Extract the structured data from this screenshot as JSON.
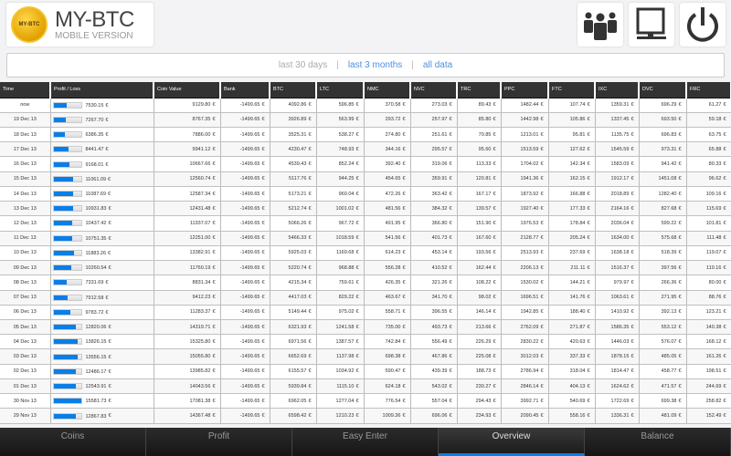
{
  "app": {
    "logo_coin_text": "MY-BTC",
    "title": "MY-BTC",
    "subtitle": "MOBILE VERSION"
  },
  "toolbar": {
    "icons": [
      "users-icon",
      "monitor-icon",
      "power-icon"
    ]
  },
  "filter": {
    "current": "last 30 days",
    "sep": "|",
    "links": [
      "last 3 months",
      "all data"
    ]
  },
  "table": {
    "columns": [
      "Time",
      "Profit / Loss",
      "Coin Value",
      "Bank",
      "BTC",
      "LTC",
      "NMC",
      "NVC",
      "TRC",
      "PPC",
      "FTC",
      "IXC",
      "DVC",
      "FRC"
    ],
    "bar_max": 15581.73,
    "rows": [
      [
        "now",
        "7530.15",
        "9129.80",
        "-1499.65",
        "4092.86",
        "596.85",
        "370.58",
        "273.03",
        "89.43",
        "1482.44",
        "107.74",
        "1359.31",
        "696.29",
        "61.27"
      ],
      [
        "19 Dec 13",
        "7267.70",
        "8767.35",
        "-1499.65",
        "3926.89",
        "563.99",
        "293.72",
        "257.97",
        "85.80",
        "1442.98",
        "105.86",
        "1337.45",
        "693.50",
        "59.18"
      ],
      [
        "18 Dec 13",
        "6386.35",
        "7886.00",
        "-1499.65",
        "3525.31",
        "538.27",
        "274.80",
        "251.61",
        "70.85",
        "1213.01",
        "95.81",
        "1135.75",
        "696.83",
        "63.75"
      ],
      [
        "17 Dec 13",
        "8441.47",
        "9941.12",
        "-1499.65",
        "4230.47",
        "748.93",
        "344.16",
        "295.57",
        "95.60",
        "1513.59",
        "127.62",
        "1545.59",
        "973.31",
        "65.88"
      ],
      [
        "16 Dec 13",
        "9168.01",
        "10667.66",
        "-1499.65",
        "4539.43",
        "852.24",
        "392.40",
        "319.06",
        "113.33",
        "1704.02",
        "142.34",
        "1583.09",
        "941.42",
        "80.33"
      ],
      [
        "15 Dec 13",
        "11061.09",
        "12560.74",
        "-1499.65",
        "5117.76",
        "944.25",
        "454.65",
        "359.91",
        "120.81",
        "1941.36",
        "162.15",
        "1912.17",
        "1451.08",
        "96.62"
      ],
      [
        "14 Dec 13",
        "11087.69",
        "12587.34",
        "-1499.65",
        "5173.21",
        "960.04",
        "472.26",
        "363.42",
        "167.17",
        "1873.92",
        "166.88",
        "2018.89",
        "1282.40",
        "109.16"
      ],
      [
        "13 Dec 13",
        "10931.83",
        "12431.48",
        "-1499.65",
        "5212.74",
        "1001.02",
        "481.56",
        "384.32",
        "139.57",
        "1927.40",
        "177.33",
        "2164.16",
        "827.68",
        "115.69"
      ],
      [
        "12 Dec 13",
        "10437.42",
        "11937.07",
        "-1499.65",
        "5066.26",
        "967.72",
        "491.95",
        "366.80",
        "151.90",
        "1976.53",
        "178.84",
        "2036.04",
        "599.22",
        "101.81"
      ],
      [
        "11 Dec 13",
        "10751.35",
        "12251.00",
        "-1499.65",
        "5466.33",
        "1018.59",
        "541.56",
        "401.73",
        "167.60",
        "2128.77",
        "205.24",
        "1634.00",
        "575.68",
        "111.48"
      ],
      [
        "10 Dec 13",
        "11883.26",
        "13382.91",
        "-1499.65",
        "5925.03",
        "1169.68",
        "614.23",
        "453.14",
        "193.56",
        "2513.93",
        "237.69",
        "1638.18",
        "518.39",
        "119.07"
      ],
      [
        "09 Dec 13",
        "10260.54",
        "11760.19",
        "-1499.65",
        "5220.74",
        "968.88",
        "556.28",
        "410.52",
        "162.44",
        "2206.13",
        "211.11",
        "1516.37",
        "397.56",
        "110.16"
      ],
      [
        "08 Dec 13",
        "7331.69",
        "8831.34",
        "-1499.65",
        "4215.34",
        "759.61",
        "426.35",
        "321.26",
        "108.22",
        "1530.02",
        "144.21",
        "979.97",
        "266.36",
        "80.00"
      ],
      [
        "07 Dec 13",
        "7912.58",
        "9412.23",
        "-1499.65",
        "4417.03",
        "829.22",
        "463.67",
        "341.70",
        "98.02",
        "1696.51",
        "141.76",
        "1063.61",
        "271.95",
        "88.76"
      ],
      [
        "06 Dec 13",
        "9783.72",
        "11283.37",
        "-1499.65",
        "5149.44",
        "975.02",
        "558.71",
        "396.55",
        "146.14",
        "1942.85",
        "188.40",
        "1410.92",
        "392.13",
        "123.21"
      ],
      [
        "05 Dec 13",
        "12820.06",
        "14319.71",
        "-1499.65",
        "6321.93",
        "1241.58",
        "735.00",
        "493.73",
        "213.66",
        "2762.09",
        "271.87",
        "1586.35",
        "553.12",
        "140.38"
      ],
      [
        "04 Dec 13",
        "13826.15",
        "15325.80",
        "-1499.65",
        "6971.56",
        "1387.57",
        "742.84",
        "556.49",
        "226.29",
        "2830.22",
        "420.63",
        "1446.03",
        "576.07",
        "168.12"
      ],
      [
        "03 Dec 13",
        "13556.15",
        "15055.80",
        "-1499.65",
        "6652.69",
        "1137.98",
        "698.38",
        "467.86",
        "225.08",
        "3012.03",
        "337.33",
        "1878.15",
        "485.05",
        "161.26"
      ],
      [
        "02 Dec 13",
        "12486.17",
        "13985.82",
        "-1499.65",
        "6155.57",
        "1034.92",
        "590.47",
        "439.39",
        "188.73",
        "2786.94",
        "318.04",
        "1814.47",
        "458.77",
        "198.51"
      ],
      [
        "01 Dec 13",
        "12543.91",
        "14043.56",
        "-1499.65",
        "5939.84",
        "1115.10",
        "624.18",
        "543.02",
        "230.27",
        "2846.14",
        "404.13",
        "1624.62",
        "471.57",
        "244.69"
      ],
      [
        "30 Nov 13",
        "15581.73",
        "17081.38",
        "-1499.65",
        "6962.05",
        "1277.04",
        "776.54",
        "557.04",
        "294.43",
        "3992.71",
        "540.69",
        "1722.69",
        "699.38",
        "258.82"
      ],
      [
        "29 Nov 13",
        "12867.83",
        "14367.48",
        "-1499.65",
        "6598.42",
        "1210.23",
        "1009.36",
        "696.06",
        "234.93",
        "2090.45",
        "558.16",
        "1336.31",
        "481.09",
        "152.49"
      ]
    ],
    "currency": "€"
  },
  "nav": {
    "tabs": [
      "Coins",
      "Profit",
      "Easy Enter",
      "Overview",
      "Balance"
    ],
    "active": "Overview",
    "accent": "#0a7ee8"
  }
}
